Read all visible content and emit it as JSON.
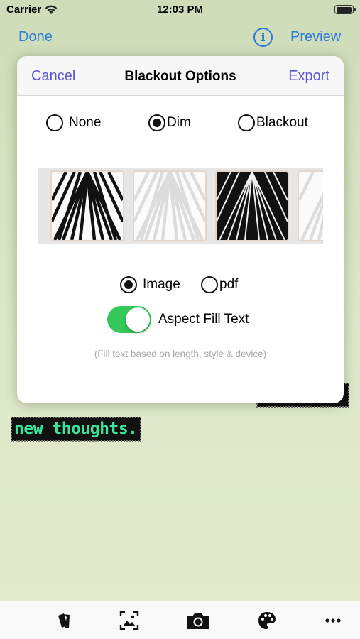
{
  "status_bar": {
    "carrier": "Carrier",
    "time": "12:03 PM"
  },
  "nav_bar": {
    "left_label": "Done",
    "info_icon": "info-circle-icon",
    "right_label": "Preview",
    "accent": "#2b7ad6"
  },
  "canvas": {
    "text_item": "new thoughts.",
    "text_color": "#3be39b"
  },
  "popover": {
    "cancel_label": "Cancel",
    "title": "Blackout Options",
    "export_label": "Export",
    "accent": "#5a55d6",
    "style_options": [
      {
        "label": "None",
        "selected": false
      },
      {
        "label": "Dim",
        "selected": true
      },
      {
        "label": "Blackout",
        "selected": false
      }
    ],
    "format_options": [
      {
        "label": "Image",
        "selected": true
      },
      {
        "label": "pdf",
        "selected": false
      }
    ],
    "toggle": {
      "label": "Aspect Fill Text",
      "on": true,
      "color": "#34c759"
    },
    "footnote": "(Fill text based on length, style & device)"
  },
  "toolbar": {
    "icons": [
      "cards-icon",
      "image-frame-icon",
      "camera-icon",
      "palette-icon",
      "more-icon"
    ]
  }
}
